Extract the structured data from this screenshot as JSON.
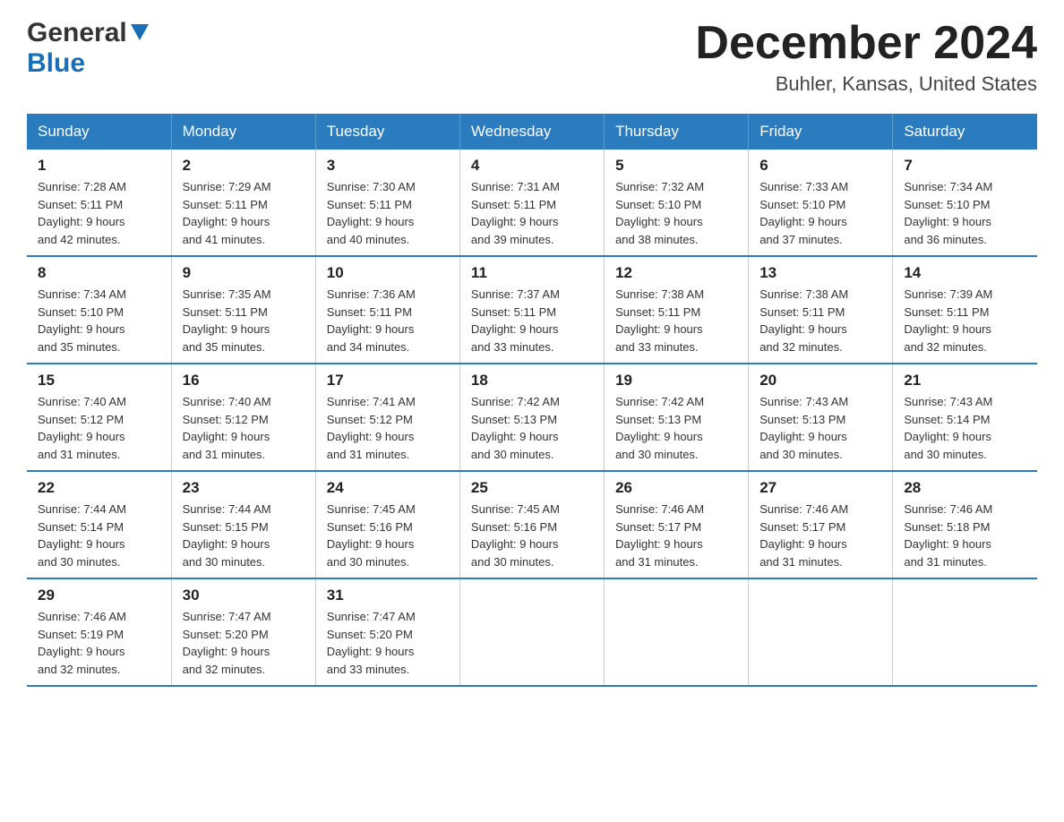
{
  "header": {
    "logo_general": "General",
    "logo_blue": "Blue",
    "month_title": "December 2024",
    "location": "Buhler, Kansas, United States"
  },
  "days_of_week": [
    "Sunday",
    "Monday",
    "Tuesday",
    "Wednesday",
    "Thursday",
    "Friday",
    "Saturday"
  ],
  "weeks": [
    [
      {
        "num": "1",
        "sunrise": "7:28 AM",
        "sunset": "5:11 PM",
        "daylight": "9 hours and 42 minutes."
      },
      {
        "num": "2",
        "sunrise": "7:29 AM",
        "sunset": "5:11 PM",
        "daylight": "9 hours and 41 minutes."
      },
      {
        "num": "3",
        "sunrise": "7:30 AM",
        "sunset": "5:11 PM",
        "daylight": "9 hours and 40 minutes."
      },
      {
        "num": "4",
        "sunrise": "7:31 AM",
        "sunset": "5:11 PM",
        "daylight": "9 hours and 39 minutes."
      },
      {
        "num": "5",
        "sunrise": "7:32 AM",
        "sunset": "5:10 PM",
        "daylight": "9 hours and 38 minutes."
      },
      {
        "num": "6",
        "sunrise": "7:33 AM",
        "sunset": "5:10 PM",
        "daylight": "9 hours and 37 minutes."
      },
      {
        "num": "7",
        "sunrise": "7:34 AM",
        "sunset": "5:10 PM",
        "daylight": "9 hours and 36 minutes."
      }
    ],
    [
      {
        "num": "8",
        "sunrise": "7:34 AM",
        "sunset": "5:10 PM",
        "daylight": "9 hours and 35 minutes."
      },
      {
        "num": "9",
        "sunrise": "7:35 AM",
        "sunset": "5:11 PM",
        "daylight": "9 hours and 35 minutes."
      },
      {
        "num": "10",
        "sunrise": "7:36 AM",
        "sunset": "5:11 PM",
        "daylight": "9 hours and 34 minutes."
      },
      {
        "num": "11",
        "sunrise": "7:37 AM",
        "sunset": "5:11 PM",
        "daylight": "9 hours and 33 minutes."
      },
      {
        "num": "12",
        "sunrise": "7:38 AM",
        "sunset": "5:11 PM",
        "daylight": "9 hours and 33 minutes."
      },
      {
        "num": "13",
        "sunrise": "7:38 AM",
        "sunset": "5:11 PM",
        "daylight": "9 hours and 32 minutes."
      },
      {
        "num": "14",
        "sunrise": "7:39 AM",
        "sunset": "5:11 PM",
        "daylight": "9 hours and 32 minutes."
      }
    ],
    [
      {
        "num": "15",
        "sunrise": "7:40 AM",
        "sunset": "5:12 PM",
        "daylight": "9 hours and 31 minutes."
      },
      {
        "num": "16",
        "sunrise": "7:40 AM",
        "sunset": "5:12 PM",
        "daylight": "9 hours and 31 minutes."
      },
      {
        "num": "17",
        "sunrise": "7:41 AM",
        "sunset": "5:12 PM",
        "daylight": "9 hours and 31 minutes."
      },
      {
        "num": "18",
        "sunrise": "7:42 AM",
        "sunset": "5:13 PM",
        "daylight": "9 hours and 30 minutes."
      },
      {
        "num": "19",
        "sunrise": "7:42 AM",
        "sunset": "5:13 PM",
        "daylight": "9 hours and 30 minutes."
      },
      {
        "num": "20",
        "sunrise": "7:43 AM",
        "sunset": "5:13 PM",
        "daylight": "9 hours and 30 minutes."
      },
      {
        "num": "21",
        "sunrise": "7:43 AM",
        "sunset": "5:14 PM",
        "daylight": "9 hours and 30 minutes."
      }
    ],
    [
      {
        "num": "22",
        "sunrise": "7:44 AM",
        "sunset": "5:14 PM",
        "daylight": "9 hours and 30 minutes."
      },
      {
        "num": "23",
        "sunrise": "7:44 AM",
        "sunset": "5:15 PM",
        "daylight": "9 hours and 30 minutes."
      },
      {
        "num": "24",
        "sunrise": "7:45 AM",
        "sunset": "5:16 PM",
        "daylight": "9 hours and 30 minutes."
      },
      {
        "num": "25",
        "sunrise": "7:45 AM",
        "sunset": "5:16 PM",
        "daylight": "9 hours and 30 minutes."
      },
      {
        "num": "26",
        "sunrise": "7:46 AM",
        "sunset": "5:17 PM",
        "daylight": "9 hours and 31 minutes."
      },
      {
        "num": "27",
        "sunrise": "7:46 AM",
        "sunset": "5:17 PM",
        "daylight": "9 hours and 31 minutes."
      },
      {
        "num": "28",
        "sunrise": "7:46 AM",
        "sunset": "5:18 PM",
        "daylight": "9 hours and 31 minutes."
      }
    ],
    [
      {
        "num": "29",
        "sunrise": "7:46 AM",
        "sunset": "5:19 PM",
        "daylight": "9 hours and 32 minutes."
      },
      {
        "num": "30",
        "sunrise": "7:47 AM",
        "sunset": "5:20 PM",
        "daylight": "9 hours and 32 minutes."
      },
      {
        "num": "31",
        "sunrise": "7:47 AM",
        "sunset": "5:20 PM",
        "daylight": "9 hours and 33 minutes."
      },
      null,
      null,
      null,
      null
    ]
  ],
  "labels": {
    "sunrise": "Sunrise:",
    "sunset": "Sunset:",
    "daylight": "Daylight:"
  }
}
